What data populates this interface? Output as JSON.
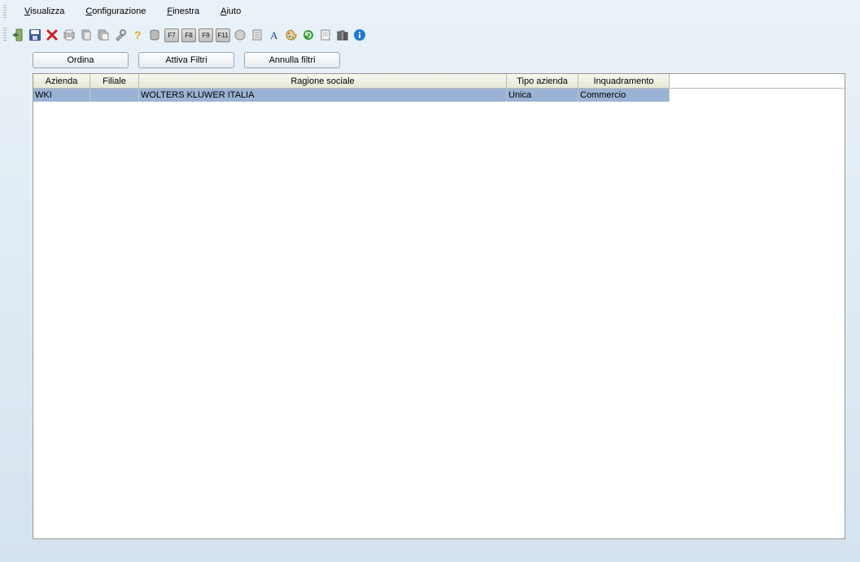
{
  "menu": {
    "visualizza": {
      "u": "V",
      "rest": "isualizza"
    },
    "configurazione": {
      "u": "C",
      "rest": "onfigurazione"
    },
    "finestra": {
      "u": "F",
      "rest": "inestra"
    },
    "aiuto": {
      "u": "A",
      "rest": "iuto"
    }
  },
  "toolbar": {
    "fkeys": [
      "F7",
      "F8",
      "F9",
      "F11"
    ]
  },
  "actions": {
    "ordina": "Ordina",
    "attiva_filtri": "Attiva Filtri",
    "annulla_filtri": "Annulla filtri"
  },
  "grid": {
    "headers": {
      "azienda": "Azienda",
      "filiale": "Filiale",
      "ragione_sociale": "Ragione sociale",
      "tipo_azienda": "Tipo azienda",
      "inquadramento": "Inquadramento"
    },
    "rows": [
      {
        "azienda": "WKI",
        "filiale": "",
        "ragione_sociale": "WOLTERS KLUWER ITALIA",
        "tipo_azienda": "Unica",
        "inquadramento": "Commercio"
      }
    ]
  }
}
